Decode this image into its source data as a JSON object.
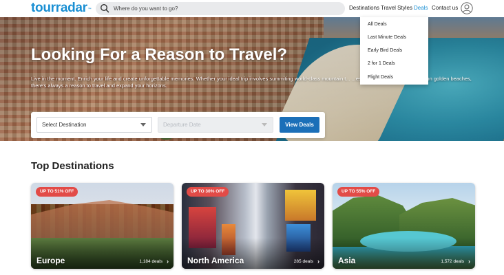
{
  "header": {
    "logo_text": "tourradar",
    "logo_tm": "™",
    "search_placeholder": "Where do you want to go?",
    "nav": [
      {
        "label": "Destinations"
      },
      {
        "label": "Travel Styles"
      },
      {
        "label": "Deals",
        "active": true
      },
      {
        "label": "Contact us"
      }
    ]
  },
  "deals_menu": {
    "items": [
      {
        "label": "All Deals"
      },
      {
        "label": "Last Minute Deals"
      },
      {
        "label": "Early Bird Deals"
      },
      {
        "label": "2 for 1 Deals"
      },
      {
        "label": "Flight Deals"
      }
    ]
  },
  "hero": {
    "title": "Looking For a Reason to Travel?",
    "subtitle": "Live in the moment. Enrich your life and create unforgettable memories. Whether your ideal trip involves summiting world-class mountain t... ...es of historic cities, or relaxing on golden beaches, there's always a reason to travel and expand your horizons.",
    "destination_select": "Select Destination",
    "date_select": "Departure Date",
    "cta": "View Deals"
  },
  "destinations": {
    "title": "Top Destinations",
    "cards": [
      {
        "badge": "UP TO 51% OFF",
        "name": "Europe",
        "count": "1,184 deals"
      },
      {
        "badge": "UP TO 30% OFF",
        "name": "North America",
        "count": "285 deals"
      },
      {
        "badge": "UP TO 55% OFF",
        "name": "Asia",
        "count": "1,572 deals"
      }
    ]
  },
  "colors": {
    "brand": "#1a8fd3",
    "cta": "#1b6fb8",
    "badge": "#e24b47"
  }
}
